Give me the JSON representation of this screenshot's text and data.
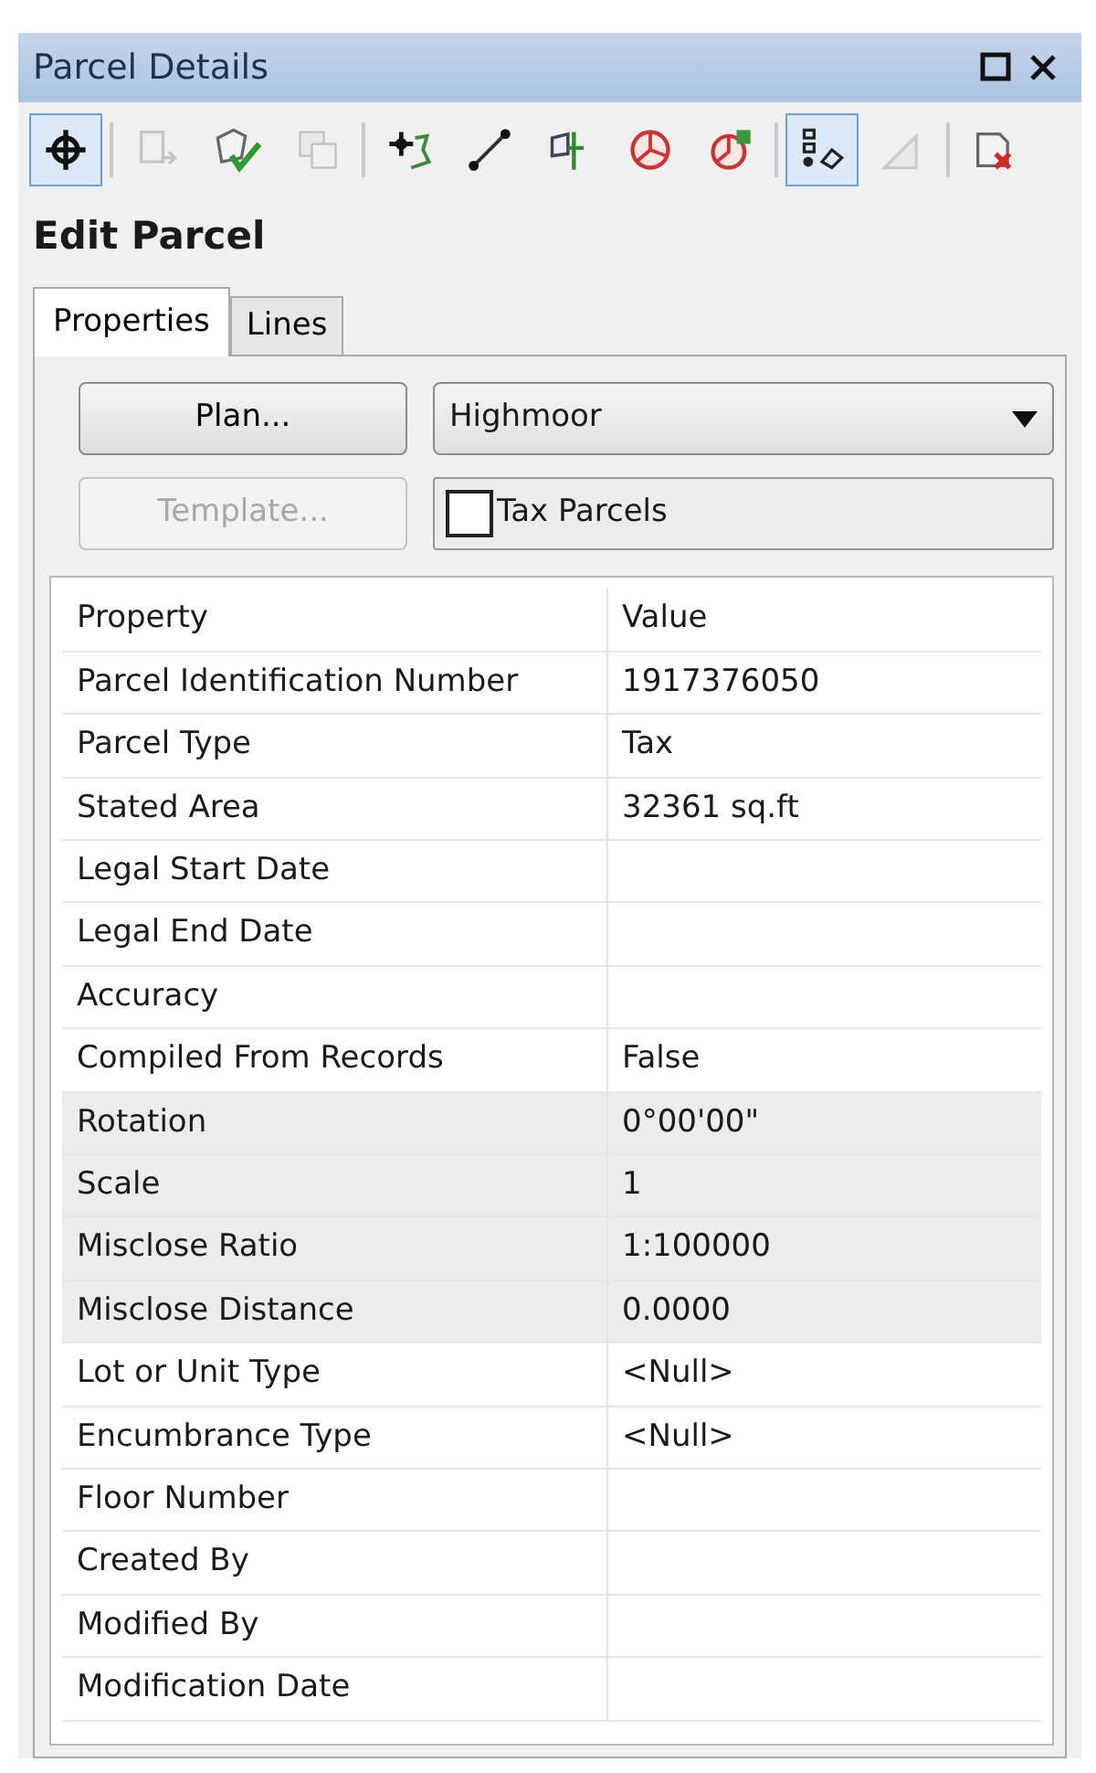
{
  "window": {
    "title": "Parcel Details",
    "controls": [
      {
        "kind": "restore"
      },
      {
        "kind": "close"
      }
    ]
  },
  "toolbar": [
    {
      "kind": "target",
      "pressed": true,
      "disabled": false
    },
    {
      "kind": "separator"
    },
    {
      "kind": "doc-arrow",
      "pressed": false,
      "disabled": true
    },
    {
      "kind": "doc-check",
      "pressed": false,
      "disabled": false
    },
    {
      "kind": "overlap",
      "pressed": false,
      "disabled": true
    },
    {
      "kind": "separator"
    },
    {
      "kind": "move-shape",
      "pressed": false,
      "disabled": false
    },
    {
      "kind": "line",
      "pressed": false,
      "disabled": false
    },
    {
      "kind": "split",
      "pressed": false,
      "disabled": false
    },
    {
      "kind": "pie",
      "pressed": false,
      "disabled": false
    },
    {
      "kind": "pie-plus",
      "pressed": false,
      "disabled": false
    },
    {
      "kind": "separator"
    },
    {
      "kind": "nodes",
      "pressed": true,
      "disabled": false
    },
    {
      "kind": "slope",
      "pressed": false,
      "disabled": true
    },
    {
      "kind": "separator"
    },
    {
      "kind": "doc-delete",
      "pressed": false,
      "disabled": false
    }
  ],
  "heading": "Edit Parcel",
  "tabs": [
    {
      "label": "Properties",
      "selected": true
    },
    {
      "label": "Lines",
      "selected": false
    }
  ],
  "plan_button": {
    "label": "Plan...",
    "disabled": false
  },
  "plan_dropdown": {
    "value": "Highmoor"
  },
  "template_button": {
    "label": "Template...",
    "disabled": true
  },
  "template_field": {
    "label": "Tax Parcels",
    "checked": false
  },
  "table": {
    "columns": [
      "Property",
      "Value"
    ],
    "rows": [
      {
        "property": "Parcel Identification Number",
        "value": "1917376050",
        "read_only": false
      },
      {
        "property": "Parcel Type",
        "value": "Tax",
        "read_only": false
      },
      {
        "property": "Stated Area",
        "value": "32361 sq.ft",
        "read_only": false
      },
      {
        "property": "Legal Start Date",
        "value": "",
        "read_only": false
      },
      {
        "property": "Legal End Date",
        "value": "",
        "read_only": false
      },
      {
        "property": "Accuracy",
        "value": "",
        "read_only": false
      },
      {
        "property": "Compiled From Records",
        "value": "False",
        "read_only": false
      },
      {
        "property": "Rotation",
        "value": "0°00'00\"",
        "read_only": true
      },
      {
        "property": "Scale",
        "value": "1",
        "read_only": true
      },
      {
        "property": "Misclose Ratio",
        "value": "1:100000",
        "read_only": true
      },
      {
        "property": "Misclose Distance",
        "value": "0.0000",
        "read_only": true
      },
      {
        "property": "Lot or Unit Type",
        "value": "<Null>",
        "read_only": false
      },
      {
        "property": "Encumbrance Type",
        "value": "<Null>",
        "read_only": false
      },
      {
        "property": "Floor Number",
        "value": "",
        "read_only": false
      },
      {
        "property": "Created By",
        "value": "",
        "read_only": false
      },
      {
        "property": "Modified By",
        "value": "",
        "read_only": false
      },
      {
        "property": "Modification Date",
        "value": "",
        "read_only": false
      }
    ]
  }
}
